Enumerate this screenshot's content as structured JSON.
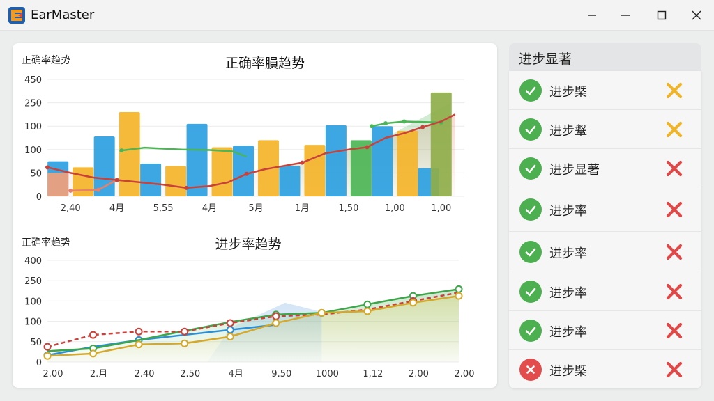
{
  "app": {
    "title": "EarMaster",
    "icon": "earmaster-logo-icon"
  },
  "window_controls": [
    "minimize-icon",
    "maximize-icon",
    "close-icon"
  ],
  "colors": {
    "blue": "#2b9fe0",
    "orange": "#f5b42a",
    "green": "#4cb556",
    "red": "#c8413b",
    "ok": "#4caf50",
    "err": "#e24c4c",
    "x_amber": "#f0b429",
    "x_red": "#e04848"
  },
  "chart_data": [
    {
      "type": "bar",
      "title": "正确率䐣趋势",
      "ylabel": "正确率趋势",
      "ytick_labels": [
        "0",
        "50",
        "100",
        "100",
        "250",
        "450"
      ],
      "categories": [
        "2,40",
        "4月",
        "5,55",
        "4月",
        "5月",
        "1月",
        "1,50",
        "1,00",
        "1,00"
      ],
      "ylim": [
        0,
        250
      ],
      "series": [
        {
          "values": [
            75,
            128,
            70,
            155,
            108,
            65,
            152,
            150,
            60
          ]
        },
        {
          "values": [
            62,
            180,
            65,
            105,
            120,
            110,
            0,
            140,
            220
          ]
        },
        {
          "values": [
            50,
            0,
            0,
            0,
            0,
            0,
            0,
            0,
            0
          ]
        },
        {
          "values": [
            0,
            0,
            0,
            0,
            0,
            0,
            120,
            0,
            222
          ]
        }
      ],
      "lines": [
        {
          "x": [
            0,
            0.6,
            1.0
          ],
          "y": [
            12,
            14,
            35
          ]
        },
        {
          "x": [
            1.1,
            1.6,
            2.0,
            2.4,
            3.0,
            3.5,
            3.8
          ],
          "y": [
            98,
            104,
            102,
            100,
            99,
            96,
            85
          ]
        },
        {
          "x": [
            6.5,
            6.8,
            7.2,
            8.0
          ],
          "y": [
            150,
            156,
            160,
            158
          ]
        },
        {
          "x": [
            -0.5,
            0,
            0.5,
            1.0,
            1.5,
            2.0,
            2.5,
            3.0,
            3.4,
            3.8,
            4.2,
            4.6,
            5.0,
            5.5,
            6.0,
            6.4,
            6.8,
            7.2,
            7.6,
            8.0,
            8.3
          ],
          "y": [
            62,
            50,
            40,
            35,
            30,
            25,
            18,
            22,
            30,
            48,
            58,
            65,
            72,
            92,
            100,
            105,
            125,
            135,
            148,
            160,
            175
          ]
        }
      ]
    },
    {
      "type": "line",
      "title": "进步率趋势",
      "ylabel": "正确率趋势",
      "ytick_labels": [
        "0",
        "50",
        "100",
        "100",
        "250",
        "400"
      ],
      "categories": [
        "2.00",
        "2.月",
        "2.40",
        "2.50",
        "4月",
        "9.50",
        "1000",
        "1,12",
        "2.00",
        "2.00"
      ],
      "ylim": [
        0,
        300
      ],
      "series": [
        {
          "values": [
            20,
            45,
            65,
            80,
            95,
            110,
            135,
            145,
            165,
            185
          ]
        },
        {
          "values": [
            32,
            40,
            65,
            92,
            118,
            140,
            145,
            170,
            195,
            215
          ]
        },
        {
          "values": [
            45,
            80,
            90,
            90,
            115,
            135,
            140,
            155,
            180,
            205
          ]
        },
        {
          "values": [
            18,
            25,
            52,
            55,
            75,
            115,
            145,
            150,
            175,
            195
          ]
        }
      ]
    }
  ],
  "sidebar": {
    "title": "进步显著",
    "items": [
      {
        "label": "进步槩",
        "ok": true,
        "x_color": "amber"
      },
      {
        "label": "进步鞶",
        "ok": true,
        "x_color": "amber"
      },
      {
        "label": "进步显著",
        "ok": true,
        "x_color": "red"
      },
      {
        "label": "进步率",
        "ok": true,
        "x_color": "red"
      },
      {
        "label": "进步率",
        "ok": true,
        "x_color": "red"
      },
      {
        "label": "进步率",
        "ok": true,
        "x_color": "red"
      },
      {
        "label": "进步率",
        "ok": true,
        "x_color": "red"
      },
      {
        "label": "进步槩",
        "ok": false,
        "x_color": "red"
      }
    ]
  }
}
